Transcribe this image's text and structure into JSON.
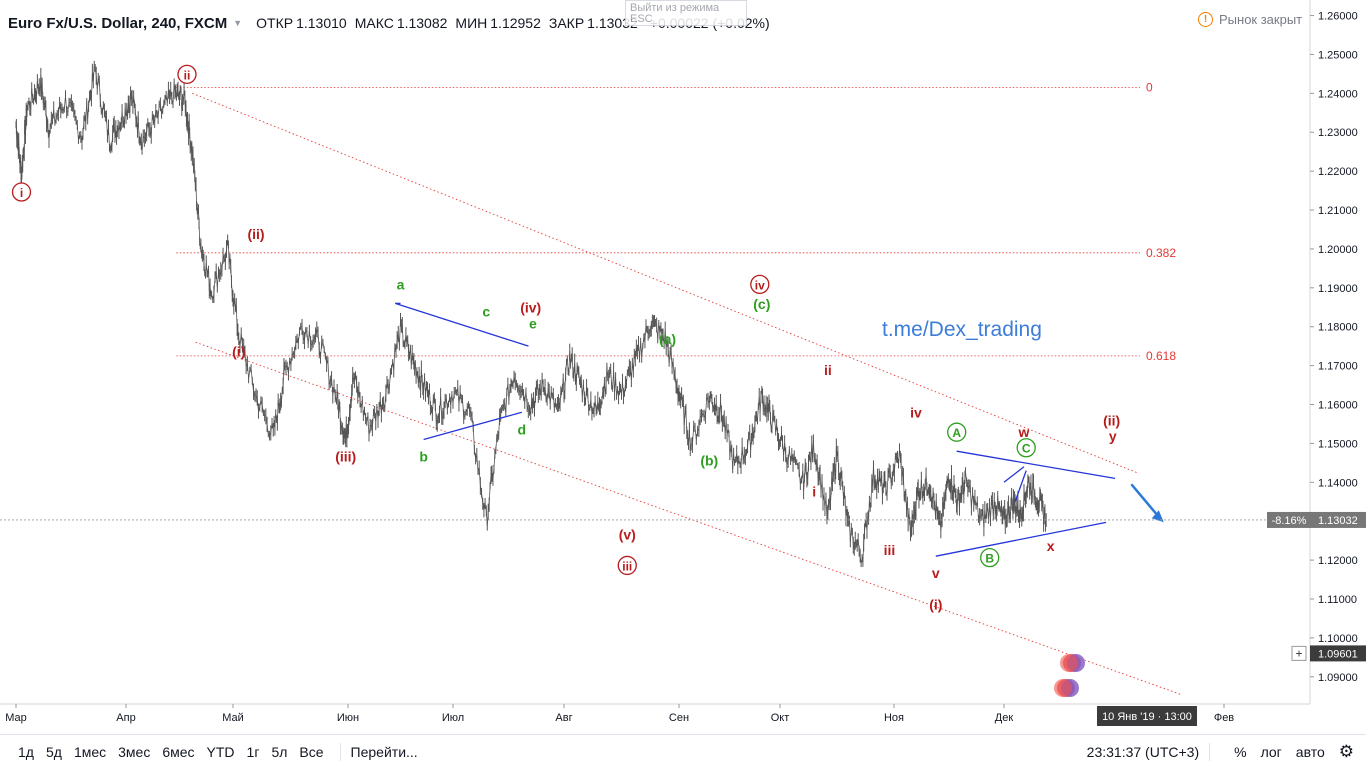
{
  "header": {
    "symbol": "Euro Fx/U.S. Dollar, 240, FXCM",
    "open_label": "ОТКР",
    "open_value": "1.13010",
    "high_label": "МАКС",
    "high_value": "1.13082",
    "low_label": "МИН",
    "low_value": "1.12952",
    "close_label": "ЗАКР",
    "close_value": "1.13032",
    "change": "+0.00022 (+0.02%)",
    "popup_line1": "Выйти из режима",
    "popup_line2": "ESC"
  },
  "status": {
    "text": "Рынок закрыт",
    "icon": "alert-circle-icon"
  },
  "watermark": "t.me/Dex_trading",
  "price_labels": {
    "last_change": "-8.16%",
    "last_price": "1.13032",
    "crosshair_price": "1.09601",
    "crosshair_time": "10 Янв '19 · 13:00"
  },
  "bottombar": {
    "timeframes": [
      "1д",
      "5д",
      "1мес",
      "3мес",
      "6мес",
      "YTD",
      "1г",
      "5л",
      "Все"
    ],
    "goto": "Перейти...",
    "clock": "23:31:37 (UTC+3)",
    "percent": "%",
    "log": "лог",
    "auto": "авто"
  },
  "colors": {
    "candles": "#555555",
    "accent_blue": "#2962ff",
    "wave_red": "#b71c1c",
    "wave_green": "#2e9e1f",
    "fib": "#e53935"
  },
  "chart_data": {
    "type": "line",
    "title": "Euro Fx/U.S. Dollar, 240, FXCM",
    "ylim": [
      1.083,
      1.264
    ],
    "y_ticks": [
      1.09,
      1.1,
      1.11,
      1.12,
      1.13,
      1.14,
      1.15,
      1.16,
      1.17,
      1.18,
      1.19,
      1.2,
      1.21,
      1.22,
      1.23,
      1.24,
      1.25,
      1.26
    ],
    "x_ticks": [
      {
        "label": "Мар",
        "t": 0
      },
      {
        "label": "Апр",
        "t": 1
      },
      {
        "label": "Май",
        "t": 2
      },
      {
        "label": "Июн",
        "t": 3
      },
      {
        "label": "Июл",
        "t": 4
      },
      {
        "label": "Авг",
        "t": 5
      },
      {
        "label": "Сен",
        "t": 6
      },
      {
        "label": "Окт",
        "t": 7
      },
      {
        "label": "Ноя",
        "t": 8
      },
      {
        "label": "Дек",
        "t": 9
      },
      {
        "label": "Фев",
        "t": 11
      }
    ],
    "series": [
      {
        "x": [
          0.0,
          0.05,
          0.1,
          0.22,
          0.3,
          0.45,
          0.6,
          0.72,
          0.85,
          0.95,
          1.05,
          1.15,
          1.3,
          1.45,
          1.55,
          1.62,
          1.7,
          1.8,
          1.95,
          2.05,
          2.2,
          2.35,
          2.45,
          2.6,
          2.75,
          2.9,
          2.98,
          3.05,
          3.2,
          3.35,
          3.5,
          3.62,
          3.72,
          3.85,
          4.0,
          4.15,
          4.3,
          4.42,
          4.55,
          4.7,
          4.82,
          4.95,
          5.05,
          5.15,
          5.28,
          5.38,
          5.5,
          5.62,
          5.75,
          5.88,
          6.0,
          6.12,
          6.3,
          6.42,
          6.55,
          6.7,
          6.82,
          6.92,
          7.05,
          7.2,
          7.3,
          7.42,
          7.5,
          7.6,
          7.72,
          7.82,
          7.92,
          8.05,
          8.15,
          8.22,
          8.32,
          8.42,
          8.5,
          8.58,
          8.65,
          8.8,
          8.92,
          9.0,
          9.08,
          9.15,
          9.22,
          9.3,
          9.38
        ],
        "y": [
          1.232,
          1.219,
          1.236,
          1.243,
          1.231,
          1.238,
          1.229,
          1.246,
          1.228,
          1.233,
          1.239,
          1.228,
          1.234,
          1.24,
          1.238,
          1.225,
          1.201,
          1.189,
          1.2,
          1.178,
          1.162,
          1.152,
          1.168,
          1.18,
          1.176,
          1.162,
          1.151,
          1.167,
          1.154,
          1.162,
          1.179,
          1.171,
          1.165,
          1.158,
          1.163,
          1.158,
          1.13,
          1.155,
          1.168,
          1.16,
          1.165,
          1.158,
          1.172,
          1.165,
          1.158,
          1.168,
          1.163,
          1.171,
          1.181,
          1.177,
          1.163,
          1.15,
          1.162,
          1.158,
          1.144,
          1.15,
          1.162,
          1.156,
          1.148,
          1.14,
          1.149,
          1.131,
          1.148,
          1.128,
          1.121,
          1.142,
          1.138,
          1.147,
          1.127,
          1.138,
          1.14,
          1.128,
          1.142,
          1.135,
          1.14,
          1.13,
          1.135,
          1.13,
          1.135,
          1.132,
          1.14,
          1.136,
          1.1303
        ]
      }
    ],
    "annotations": [
      {
        "text": "i",
        "t": 0.05,
        "y": 1.219,
        "color": "red",
        "circled": true,
        "pos": "below"
      },
      {
        "text": "ii",
        "t": 1.57,
        "y": 1.24,
        "color": "red",
        "circled": true,
        "pos": "above"
      },
      {
        "text": "(i)",
        "t": 2.05,
        "y": 1.178,
        "color": "red",
        "circled": false,
        "pos": "below"
      },
      {
        "text": "(ii)",
        "t": 2.2,
        "y": 1.199,
        "color": "red",
        "circled": false,
        "pos": "above"
      },
      {
        "text": "(iii)",
        "t": 2.98,
        "y": 1.151,
        "color": "red",
        "circled": false,
        "pos": "below"
      },
      {
        "text": "a",
        "t": 3.5,
        "y": 1.186,
        "color": "green",
        "circled": false,
        "pos": "above"
      },
      {
        "text": "b",
        "t": 3.72,
        "y": 1.151,
        "color": "green",
        "circled": false,
        "pos": "below"
      },
      {
        "text": "c",
        "t": 4.3,
        "y": 1.179,
        "color": "green",
        "circled": false,
        "pos": "above"
      },
      {
        "text": "d",
        "t": 4.62,
        "y": 1.158,
        "color": "green",
        "circled": false,
        "pos": "below"
      },
      {
        "text": "(iv)",
        "t": 4.7,
        "y": 1.18,
        "color": "red",
        "circled": false,
        "pos": "above"
      },
      {
        "text": "e",
        "t": 4.72,
        "y": 1.176,
        "color": "green",
        "circled": false,
        "pos": "above"
      },
      {
        "text": "(v)",
        "t": 5.55,
        "y": 1.131,
        "color": "red",
        "circled": false,
        "pos": "below"
      },
      {
        "text": "iii",
        "t": 5.55,
        "y": 1.123,
        "color": "red",
        "circled": true,
        "pos": "below"
      },
      {
        "text": "(a)",
        "t": 5.9,
        "y": 1.172,
        "color": "green",
        "circled": false,
        "pos": "above"
      },
      {
        "text": "(b)",
        "t": 6.3,
        "y": 1.15,
        "color": "green",
        "circled": false,
        "pos": "below"
      },
      {
        "text": "(c)",
        "t": 6.82,
        "y": 1.181,
        "color": "green",
        "circled": false,
        "pos": "above"
      },
      {
        "text": "iv",
        "t": 6.8,
        "y": 1.186,
        "color": "red",
        "circled": true,
        "pos": "above"
      },
      {
        "text": "i",
        "t": 7.3,
        "y": 1.142,
        "color": "red",
        "circled": false,
        "pos": "below"
      },
      {
        "text": "ii",
        "t": 7.42,
        "y": 1.164,
        "color": "red",
        "circled": false,
        "pos": "above"
      },
      {
        "text": "iii",
        "t": 7.96,
        "y": 1.127,
        "color": "red",
        "circled": false,
        "pos": "below"
      },
      {
        "text": "iv",
        "t": 8.2,
        "y": 1.153,
        "color": "red",
        "circled": false,
        "pos": "above"
      },
      {
        "text": "v",
        "t": 8.38,
        "y": 1.121,
        "color": "red",
        "circled": false,
        "pos": "below"
      },
      {
        "text": "(i)",
        "t": 8.38,
        "y": 1.113,
        "color": "red",
        "circled": false,
        "pos": "below"
      },
      {
        "text": "A",
        "t": 8.57,
        "y": 1.148,
        "color": "green",
        "circled": true,
        "pos": "above"
      },
      {
        "text": "B",
        "t": 8.87,
        "y": 1.125,
        "color": "green",
        "circled": true,
        "pos": "below"
      },
      {
        "text": "C",
        "t": 9.2,
        "y": 1.144,
        "color": "green",
        "circled": true,
        "pos": "above"
      },
      {
        "text": "w",
        "t": 9.18,
        "y": 1.148,
        "color": "red",
        "circled": false,
        "pos": "above"
      },
      {
        "text": "x",
        "t": 9.42,
        "y": 1.128,
        "color": "red",
        "circled": false,
        "pos": "below"
      },
      {
        "text": "(ii)",
        "t": 9.97,
        "y": 1.151,
        "color": "red",
        "circled": false,
        "pos": "above"
      },
      {
        "text": "y",
        "t": 9.98,
        "y": 1.147,
        "color": "red",
        "circled": false,
        "pos": "above"
      }
    ],
    "fib_levels": [
      {
        "label": "0",
        "y": 1.2415
      },
      {
        "label": "0.382",
        "y": 1.199
      },
      {
        "label": "0.618",
        "y": 1.1725
      }
    ],
    "last_price": 1.13032,
    "crosshair_price": 1.09601
  }
}
